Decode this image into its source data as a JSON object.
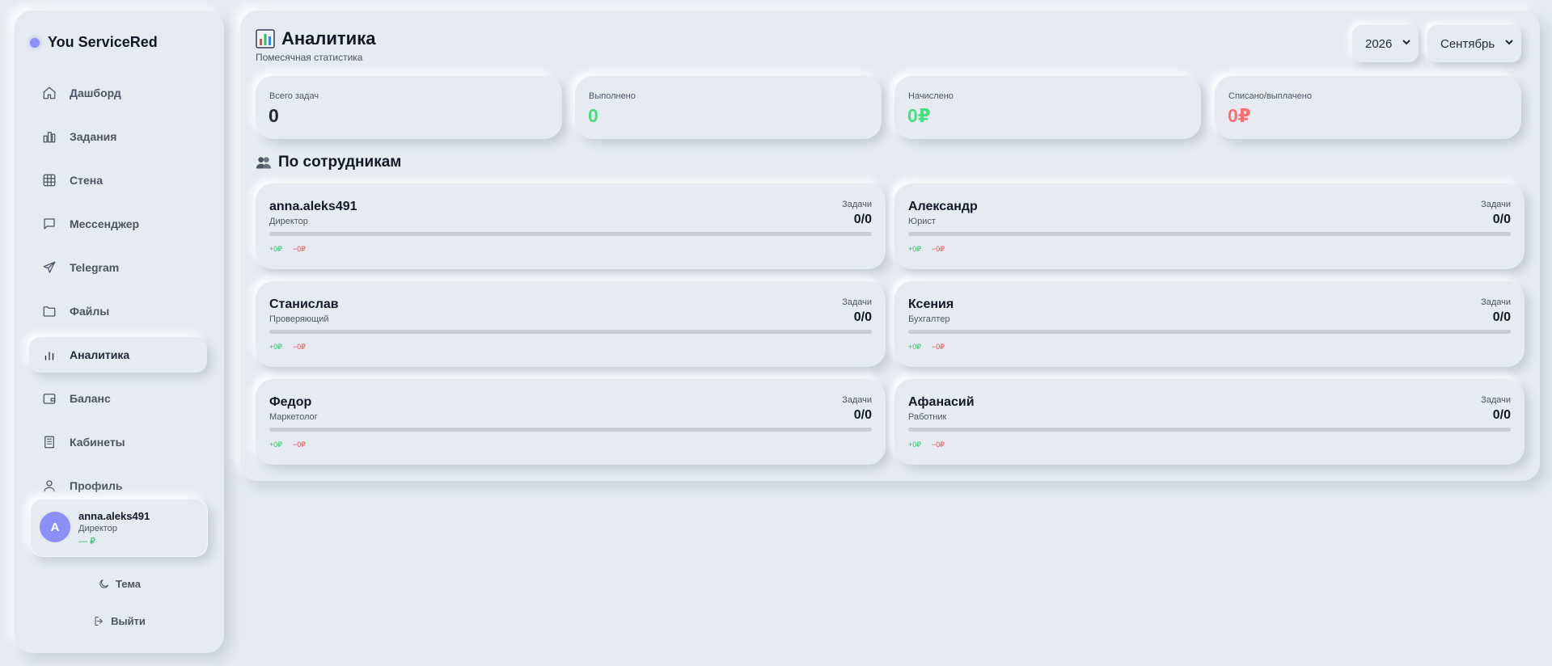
{
  "sidebar": {
    "brand": "You ServiceRed",
    "items": [
      {
        "label": "Дашборд",
        "icon": "home-icon"
      },
      {
        "label": "Задания",
        "icon": "bar-chart-icon"
      },
      {
        "label": "Стена",
        "icon": "grid-icon"
      },
      {
        "label": "Мессенджер",
        "icon": "message-icon"
      },
      {
        "label": "Telegram",
        "icon": "send-icon"
      },
      {
        "label": "Файлы",
        "icon": "folder-icon"
      },
      {
        "label": "Аналитика",
        "icon": "analytics-icon",
        "active": true
      },
      {
        "label": "Баланс",
        "icon": "wallet-icon"
      },
      {
        "label": "Кабинеты",
        "icon": "building-icon"
      },
      {
        "label": "Профиль",
        "icon": "user-icon"
      }
    ],
    "user": {
      "initial": "A",
      "name": "anna.aleks491",
      "role": "Директор",
      "balance": "— ₽"
    },
    "theme_label": "Тема",
    "logout_label": "Выйти"
  },
  "header": {
    "title": "Аналитика",
    "subtitle": "Помесячная статистика",
    "year": "2026",
    "month": "Сентябрь"
  },
  "stats": [
    {
      "label": "Всего задач",
      "value": "0",
      "color": "#1f2937"
    },
    {
      "label": "Выполнено",
      "value": "0",
      "color": "#4ade80"
    },
    {
      "label": "Начислено",
      "value": "0₽",
      "color": "#4ade80"
    },
    {
      "label": "Списано/выплачено",
      "value": "0₽",
      "color": "#f87171"
    }
  ],
  "section_title": "По сотрудникам",
  "employees": [
    {
      "name": "anna.aleks491",
      "role": "Директор",
      "tasks_label": "Задачи",
      "tasks": "0/0",
      "plus": "+0₽",
      "minus": "−0₽",
      "progress": 0
    },
    {
      "name": "Александр",
      "role": "Юрист",
      "tasks_label": "Задачи",
      "tasks": "0/0",
      "plus": "+0₽",
      "minus": "−0₽",
      "progress": 0
    },
    {
      "name": "Станислав",
      "role": "Проверяющий",
      "tasks_label": "Задачи",
      "tasks": "0/0",
      "plus": "+0₽",
      "minus": "−0₽",
      "progress": 0
    },
    {
      "name": "Ксения",
      "role": "Бухгалтер",
      "tasks_label": "Задачи",
      "tasks": "0/0",
      "plus": "+0₽",
      "minus": "−0₽",
      "progress": 0
    },
    {
      "name": "Федор",
      "role": "Маркетолог",
      "tasks_label": "Задачи",
      "tasks": "0/0",
      "plus": "+0₽",
      "minus": "−0₽",
      "progress": 0
    },
    {
      "name": "Афанасий",
      "role": "Работник",
      "tasks_label": "Задачи",
      "tasks": "0/0",
      "plus": "+0₽",
      "minus": "−0₽",
      "progress": 0
    }
  ],
  "colors": {
    "accent": "#8b8ff8",
    "positive": "#22c55e",
    "negative": "#ef4444",
    "background": "#e6ebf2"
  }
}
